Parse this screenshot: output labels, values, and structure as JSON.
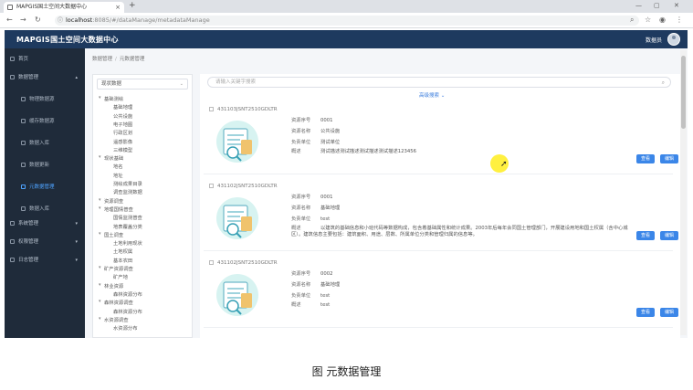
{
  "browser": {
    "tab_title": "MAPGIS国土空间大数据中心",
    "url_host": "localhost",
    "url_path": ":8085/#/dataManage/metadataManage"
  },
  "app": {
    "title": "MAPGIS国土空间大数据中心",
    "user": "数据员"
  },
  "sidebar": {
    "items": [
      {
        "label": "首页"
      },
      {
        "label": "数据管理"
      },
      {
        "label": "物理数据源"
      },
      {
        "label": "缓存数据源"
      },
      {
        "label": "数据入库"
      },
      {
        "label": "数据更新"
      },
      {
        "label": "元数据管理"
      },
      {
        "label": "数据入库"
      },
      {
        "label": "系统管理"
      },
      {
        "label": "权限管理"
      },
      {
        "label": "日志管理"
      }
    ]
  },
  "breadcrumb": {
    "parent": "数据管理",
    "current": "元数据管理"
  },
  "tree": {
    "select_value": "现状数据",
    "nodes": [
      {
        "label": "基础测绘",
        "level": 1
      },
      {
        "label": "基础地理",
        "level": 2
      },
      {
        "label": "公共设施",
        "level": 2
      },
      {
        "label": "电子地图",
        "level": 2
      },
      {
        "label": "行政区划",
        "level": 2
      },
      {
        "label": "遥感影像",
        "level": 2
      },
      {
        "label": "三维模型",
        "level": 2
      },
      {
        "label": "现状基础",
        "level": 1
      },
      {
        "label": "地名",
        "level": 2
      },
      {
        "label": "地址",
        "level": 2
      },
      {
        "label": "测绘成果目录",
        "level": 2
      },
      {
        "label": "调查监测数据",
        "level": 2
      },
      {
        "label": "资源调查",
        "level": 1
      },
      {
        "label": "地理国情普查",
        "level": 1
      },
      {
        "label": "国情监测普查",
        "level": 2
      },
      {
        "label": "地表覆盖分类",
        "level": 2
      },
      {
        "label": "国土调查",
        "level": 1
      },
      {
        "label": "土地利用现状",
        "level": 2
      },
      {
        "label": "土地权属",
        "level": 2
      },
      {
        "label": "基本农田",
        "level": 2
      },
      {
        "label": "矿产资源调查",
        "level": 1
      },
      {
        "label": "矿产地",
        "level": 2
      },
      {
        "label": "林业资源",
        "level": 1
      },
      {
        "label": "森林资源分布",
        "level": 2
      },
      {
        "label": "森林资源调查",
        "level": 1
      },
      {
        "label": "森林资源分布",
        "level": 2
      },
      {
        "label": "水资源调查",
        "level": 1
      },
      {
        "label": "水资源分布",
        "level": 2
      }
    ]
  },
  "search": {
    "placeholder": "请输入关键字搜索",
    "advanced_label": "高级搜索 ⌄"
  },
  "records": [
    {
      "id": "431103JSNT2510GDLTR",
      "code": "0001",
      "name": "公共设施",
      "unit": "测试单位",
      "desc": "测试描述测试描述测试描述测试描述123456",
      "btn_view": "查看",
      "btn_edit": "编辑"
    },
    {
      "id": "431102JSNT2510GDLTR",
      "code": "0001",
      "name": "基础地理",
      "unit": "test",
      "desc": "以建筑的基础信息和小班代码等数据构成，包含着基础属性和统计成果。2003年后每年会同国土管理部门，开展建设用地和国土权属（含中心城区）。建筑信息主要包括：建筑面积、用途、层数、所属单位分类和管理归属的信息等。",
      "btn_view": "查看",
      "btn_edit": "编辑"
    },
    {
      "id": "431102JSNT2510GDLTR",
      "code": "0002",
      "name": "基础地理",
      "unit": "test",
      "desc": "test",
      "btn_view": "查看",
      "btn_edit": "编辑"
    }
  ],
  "field_labels": {
    "code": "资源序号",
    "name": "资源名称",
    "unit": "负责单位",
    "desc": "概述"
  },
  "caption": "图 元数据管理",
  "colors": {
    "header": "#1e3a5f",
    "sidebar": "#1f2b3a",
    "accent": "#3b86e8"
  }
}
